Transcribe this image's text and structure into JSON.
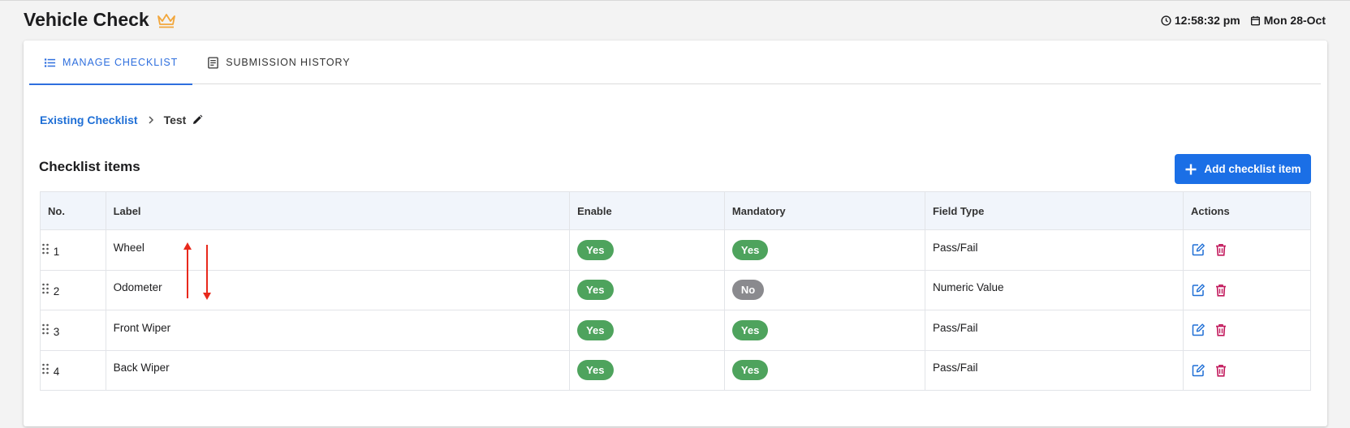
{
  "app": {
    "title": "Vehicle Check",
    "crown_color": "#f2a63b"
  },
  "clock": {
    "time": "12:58:32 pm",
    "date": "Mon 28-Oct"
  },
  "tabs": [
    {
      "label": "MANAGE CHECKLIST",
      "icon": "list-icon",
      "active": true
    },
    {
      "label": "SUBMISSION HISTORY",
      "icon": "document-icon",
      "active": false
    }
  ],
  "breadcrumb": {
    "parent": "Existing Checklist",
    "current": "Test"
  },
  "section": {
    "title": "Checklist items",
    "add_label": "Add checklist item"
  },
  "table": {
    "headers": {
      "no": "No.",
      "label": "Label",
      "enable": "Enable",
      "mandatory": "Mandatory",
      "field_type": "Field Type",
      "actions": "Actions"
    },
    "rows": [
      {
        "no": "1",
        "label": "Wheel",
        "enable": "Yes",
        "mandatory": "Yes",
        "field_type": "Pass/Fail"
      },
      {
        "no": "2",
        "label": "Odometer",
        "enable": "Yes",
        "mandatory": "No",
        "field_type": "Numeric Value"
      },
      {
        "no": "3",
        "label": "Front Wiper",
        "enable": "Yes",
        "mandatory": "Yes",
        "field_type": "Pass/Fail"
      },
      {
        "no": "4",
        "label": "Back Wiper",
        "enable": "Yes",
        "mandatory": "Yes",
        "field_type": "Pass/Fail"
      }
    ]
  },
  "colors": {
    "accent": "#1b6fe6",
    "yes": "#4ea35d",
    "no": "#8a8a8e",
    "delete": "#c2185b",
    "annotation": "#e8291c"
  }
}
